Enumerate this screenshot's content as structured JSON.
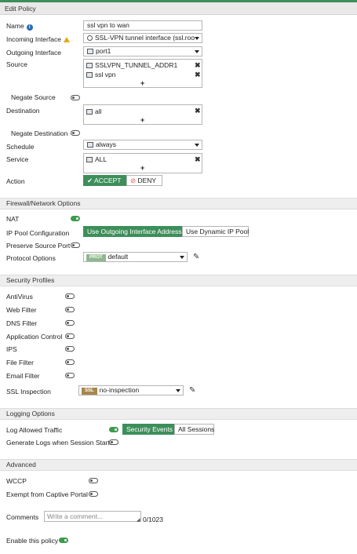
{
  "header": {
    "title": "Edit Policy"
  },
  "fields": {
    "name": {
      "label": "Name",
      "value": "ssl vpn to wan"
    },
    "incoming": {
      "label": "Incoming Interface",
      "value": "SSL-VPN tunnel interface (ssl.roo"
    },
    "outgoing": {
      "label": "Outgoing Interface",
      "value": "port1"
    },
    "source": {
      "label": "Source",
      "items": [
        "SSLVPN_TUNNEL_ADDR1",
        "ssl vpn"
      ],
      "add": "+"
    },
    "negate_source": {
      "label": "Negate Source"
    },
    "destination": {
      "label": "Destination",
      "items": [
        "all"
      ],
      "add": "+"
    },
    "negate_destination": {
      "label": "Negate Destination"
    },
    "schedule": {
      "label": "Schedule",
      "value": "always"
    },
    "service": {
      "label": "Service",
      "items": [
        "ALL"
      ],
      "add": "+"
    },
    "action": {
      "label": "Action",
      "accept": "ACCEPT",
      "deny": "DENY"
    }
  },
  "firewall": {
    "title": "Firewall/Network Options",
    "nat": "NAT",
    "ip_pool": {
      "label": "IP Pool Configuration",
      "opt1": "Use Outgoing Interface Address",
      "opt2": "Use Dynamic IP Pool"
    },
    "preserve": "Preserve Source Port",
    "protocol": {
      "label": "Protocol Options",
      "badge": "PROT",
      "value": "default"
    }
  },
  "security": {
    "title": "Security Profiles",
    "items": [
      "AntiVirus",
      "Web Filter",
      "DNS Filter",
      "Application Control",
      "IPS",
      "File Filter",
      "Email Filter"
    ],
    "ssl": {
      "label": "SSL Inspection",
      "badge": "SSL",
      "value": "no-inspection"
    }
  },
  "logging": {
    "title": "Logging Options",
    "allowed": {
      "label": "Log Allowed Traffic",
      "opt1": "Security Events",
      "opt2": "All Sessions"
    },
    "session_start": "Generate Logs when Session Starts"
  },
  "advanced": {
    "title": "Advanced",
    "wccp": "WCCP",
    "captive": "Exempt from Captive Portal"
  },
  "comments": {
    "label": "Comments",
    "placeholder": "Write a comment...",
    "counter": "0/1023"
  },
  "enable": {
    "label": "Enable this policy"
  },
  "colors": {
    "accent": "#3d8f5a",
    "toggle_on": "#3d9a4e",
    "deny": "#d9534f",
    "ssl_badge": "#a8874a",
    "prot_badge": "#8fb88f"
  }
}
